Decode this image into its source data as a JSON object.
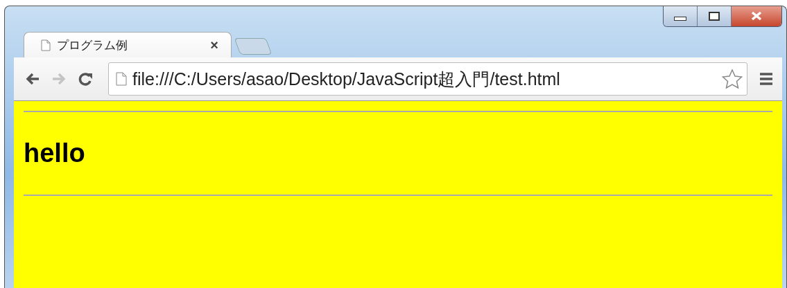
{
  "tabs": [
    {
      "title": "プログラム例",
      "close": "×",
      "selected": true
    }
  ],
  "toolbar": {
    "nav": [
      {
        "kind": "back",
        "disabled": false
      },
      {
        "kind": "forward",
        "disabled": true
      },
      {
        "kind": "reload",
        "disabled": false
      }
    ],
    "address": "file:///C:/Users/asao/Desktop/JavaScript超入門/test.html"
  },
  "content": {
    "heading": "hello"
  }
}
